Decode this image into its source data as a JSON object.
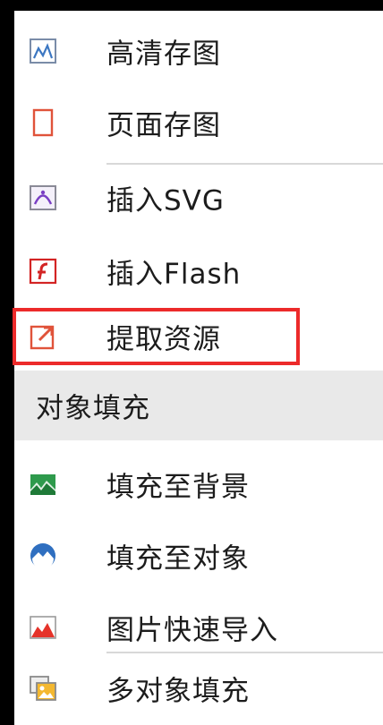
{
  "menu": {
    "items": [
      {
        "label": "高清存图",
        "icon": "hd-image-icon"
      },
      {
        "label": "页面存图",
        "icon": "page-image-icon"
      },
      {
        "label": "插入SVG",
        "icon": "svg-icon"
      },
      {
        "label": "插入Flash",
        "icon": "flash-icon"
      },
      {
        "label": "提取资源",
        "icon": "extract-icon"
      }
    ],
    "section_title": "对象填充",
    "fill_items": [
      {
        "label": "填充至背景",
        "icon": "fill-background-icon"
      },
      {
        "label": "填充至对象",
        "icon": "fill-object-icon"
      },
      {
        "label": "图片快速导入",
        "icon": "quick-import-icon"
      },
      {
        "label": "多对象填充",
        "icon": "multi-fill-icon"
      }
    ]
  },
  "colors": {
    "highlight": "#ec2a2a",
    "section_bg": "#e9e9e9",
    "background": "#000000"
  }
}
